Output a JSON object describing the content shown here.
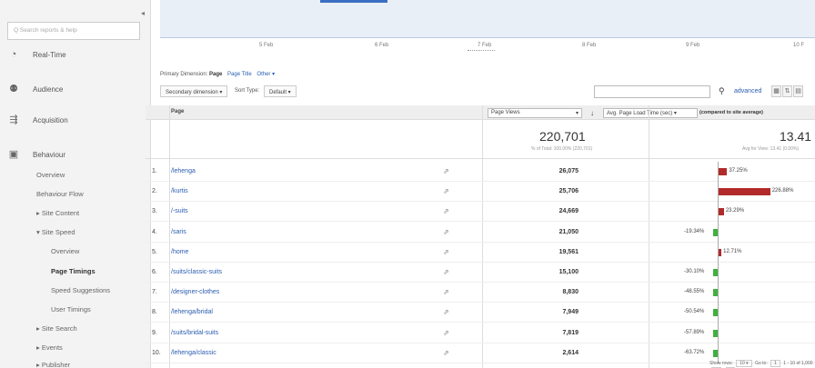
{
  "sidebar": {
    "search_placeholder": "Q Search reports & help",
    "collapse_icon": "◂",
    "sections": [
      {
        "label": "Real-Time",
        "icon": "realtime-icon"
      },
      {
        "label": "Audience",
        "icon": "audience-icon"
      },
      {
        "label": "Acquisition",
        "icon": "acquisition-icon"
      },
      {
        "label": "Behaviour",
        "icon": "behaviour-icon"
      }
    ],
    "items": [
      {
        "label": "Overview"
      },
      {
        "label": "Behaviour Flow"
      },
      {
        "label": "▸ Site Content"
      },
      {
        "label": "▾ Site Speed"
      },
      {
        "label": "Overview"
      },
      {
        "label": "Page Timings"
      },
      {
        "label": "Speed Suggestions"
      },
      {
        "label": "User Timings"
      },
      {
        "label": "▸ Site Search"
      },
      {
        "label": "▸ Events"
      },
      {
        "label": "▸ Publisher"
      }
    ]
  },
  "timeline": {
    "ticks": [
      "5 Feb",
      "6 Feb",
      "7 Feb",
      "8 Feb",
      "9 Feb",
      "10 F"
    ]
  },
  "dimensions": {
    "label": "Primary Dimension:",
    "page": "Page",
    "page_title": "Page Title",
    "other": "Other ▾"
  },
  "toolbar": {
    "secondary": "Secondary dimension ▾",
    "sort_type": "Sort Type:",
    "default": "Default ▾",
    "advanced": "advanced"
  },
  "table": {
    "col_page": "Page",
    "metric1_select": "Page Views",
    "metric1_arrow": "▾",
    "sort_arrow": "↓",
    "metric2_select": "Avg. Page Load Time (sec) ▾",
    "metric2_note": "(compared to site average)",
    "total_pv": "220,701",
    "total_pv_sub": "% of Total: 100.00% (220,701)",
    "total_load": "13.41",
    "total_load_sub": "Avg for View: 13.41 (0.00%)",
    "rows": [
      {
        "n": "1.",
        "page": "/lehenga",
        "pv": "26,075",
        "pct": "37.25%"
      },
      {
        "n": "2.",
        "page": "/kurtis",
        "pv": "25,706",
        "pct": "226.88%"
      },
      {
        "n": "3.",
        "page": "/-suits",
        "pv": "24,669",
        "pct": "23.29%"
      },
      {
        "n": "4.",
        "page": "/saris",
        "pv": "21,050",
        "pct": "-19.34%"
      },
      {
        "n": "5.",
        "page": "/home",
        "pv": "19,561",
        "pct": "12.71%"
      },
      {
        "n": "6.",
        "page": "/suits/classic-suits",
        "pv": "15,100",
        "pct": "-30.10%"
      },
      {
        "n": "7.",
        "page": "/designer-clothes",
        "pv": "8,830",
        "pct": "-48.55%"
      },
      {
        "n": "8.",
        "page": "/lehenga/bridal",
        "pv": "7,949",
        "pct": "-50.54%"
      },
      {
        "n": "9.",
        "page": "/suits/bridal-suits",
        "pv": "7,819",
        "pct": "-57.89%"
      },
      {
        "n": "10.",
        "page": "/lehenga/classic",
        "pv": "2,614",
        "pct": "-63.72%"
      }
    ]
  },
  "footer": {
    "show_rows": "Show rows:",
    "rows_value": "10 ▾",
    "goto": "Go to:",
    "goto_value": "1",
    "range": "1 - 10 of 1,000",
    "prev": "◂",
    "next": "▸"
  }
}
